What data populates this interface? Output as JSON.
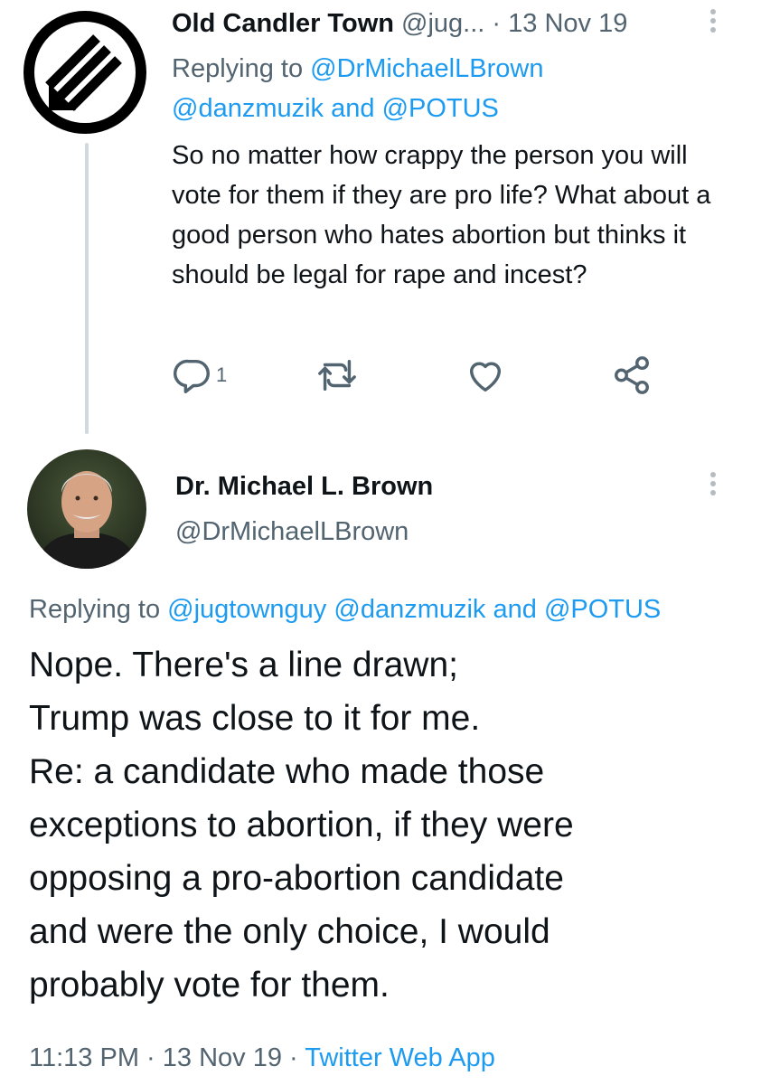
{
  "tweet1": {
    "display_name": "Old Candler Town",
    "handle": "@jug...",
    "separator": "·",
    "date": "13 Nov 19",
    "replying_prefix": "Replying to ",
    "reply_mention_1": "@DrMichaelLBrown",
    "reply_mention_2": "@danzmuzik",
    "reply_and": " and ",
    "reply_mention_3": "@POTUS",
    "text": "So no matter how crappy the person you will vote for them if they are pro life? What about a good person who hates abortion but thinks it should be legal for rape and incest?",
    "reply_count": "1",
    "avatar_icon": "iron-cross-icon"
  },
  "tweet2": {
    "display_name": "Dr. Michael L. Brown",
    "handle": "@DrMichaelLBrown",
    "replying_prefix": "Replying to ",
    "reply_mention_1": "@jugtownguy",
    "reply_mention_2": "@danzmuzik",
    "reply_and": " and ",
    "reply_mention_3": "@POTUS",
    "text_lines": [
      "Nope. There's a line drawn;",
      "Trump was close to it for me.",
      "Re: a candidate who made those",
      "exceptions to abortion, if they were",
      "opposing a pro-abortion candidate",
      "and were the only choice, I would",
      "probably vote for them."
    ],
    "time": "11:13 PM",
    "separator": " · ",
    "date": "13 Nov 19",
    "source": "Twitter Web App"
  },
  "colors": {
    "link": "#1d9bf0",
    "secondary_text": "#536471",
    "primary_text": "#0f1419",
    "thread_line": "#cfd9de"
  }
}
